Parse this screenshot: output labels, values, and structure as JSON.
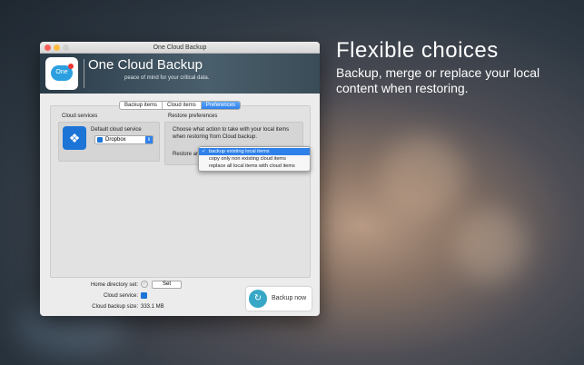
{
  "promo": {
    "title": "Flexible choices",
    "subtitle": "Backup, merge or replace your local content when restoring."
  },
  "window": {
    "title": "One Cloud Backup"
  },
  "banner": {
    "app_name": "One Cloud Backup",
    "tagline": "peace of mind for your critical data.",
    "icon_text": "One"
  },
  "tabs": [
    {
      "label": "Backup items",
      "active": false
    },
    {
      "label": "Cloud items",
      "active": false
    },
    {
      "label": "Preferences",
      "active": true
    }
  ],
  "cloud_services": {
    "heading": "Cloud services",
    "default_label": "Default cloud service",
    "selected": "Dropbox"
  },
  "restore": {
    "heading": "Restore preferences",
    "description": "Choose what action to take with your local items when restoring from Cloud backup.",
    "restore_as_label": "Restore an",
    "options": [
      {
        "label": "backup existing local items",
        "selected": true
      },
      {
        "label": "copy only non existing cloud items",
        "selected": false
      },
      {
        "label": "replace all local items with cloud items",
        "selected": false
      }
    ]
  },
  "footer": {
    "home_dir_label": "Home directory set:",
    "set_button": "Set",
    "cloud_service_label": "Cloud service:",
    "backup_size_label": "Cloud backup size:",
    "backup_size_value": "333.1 MB",
    "backup_now": "Backup now"
  },
  "colors": {
    "accent": "#2f81ea",
    "dropbox": "#1b74d6",
    "brand": "#37a7c6"
  }
}
